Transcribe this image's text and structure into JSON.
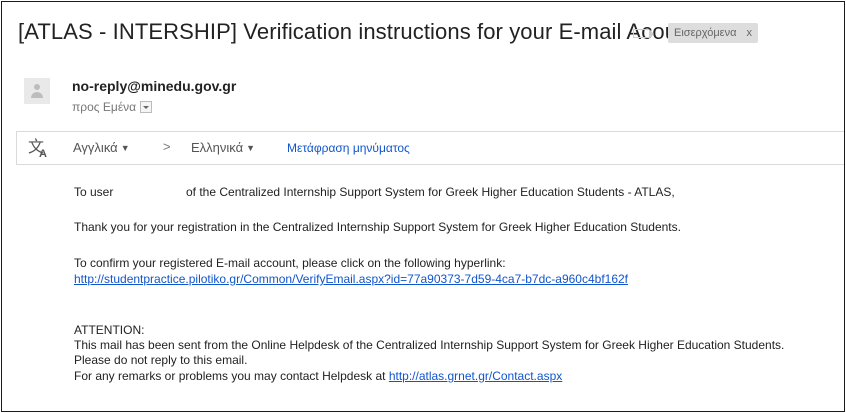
{
  "subject": "[ATLAS - INTERSHIP] Verification instructions for your E-mail Acount",
  "label": {
    "icon": "label-outline-icon",
    "text": "Εισερχόμενα",
    "remove": "x"
  },
  "sender": {
    "email": "no-reply@minedu.gov.gr",
    "to": "προς Εμένα",
    "avatar_icon": "default-person-icon"
  },
  "translate": {
    "icon": "translate-icon",
    "source_lang": "Αγγλικά",
    "arrow": ">",
    "target_lang": "Ελληνικά",
    "action": "Μετάφραση μηνύματος"
  },
  "message": {
    "greeting_to": "To user",
    "greeting_rest": "of the Centralized Internship Support System for Greek Higher Education Students - ATLAS,",
    "thanks": "Thank you for your registration in the Centralized Internship Support System for Greek Higher Education Students.",
    "confirm": "To confirm your registered E-mail account, please click on the following hyperlink:",
    "verify_link": "http://studentpractice.pilotiko.gr/Common/VerifyEmail.aspx?id=77a90373-7d59-4ca7-b7dc-a960c4bf162f",
    "attention": "ATTENTION:",
    "notice": "This mail has been sent from the Online Helpdesk of the Centralized Internship Support System for Greek Higher Education Students.",
    "no_reply": "Please do not reply to this email.",
    "contact_prefix": "For any remarks or problems you may contact Helpdesk at",
    "contact_link": "http://atlas.grnet.gr/Contact.aspx"
  }
}
